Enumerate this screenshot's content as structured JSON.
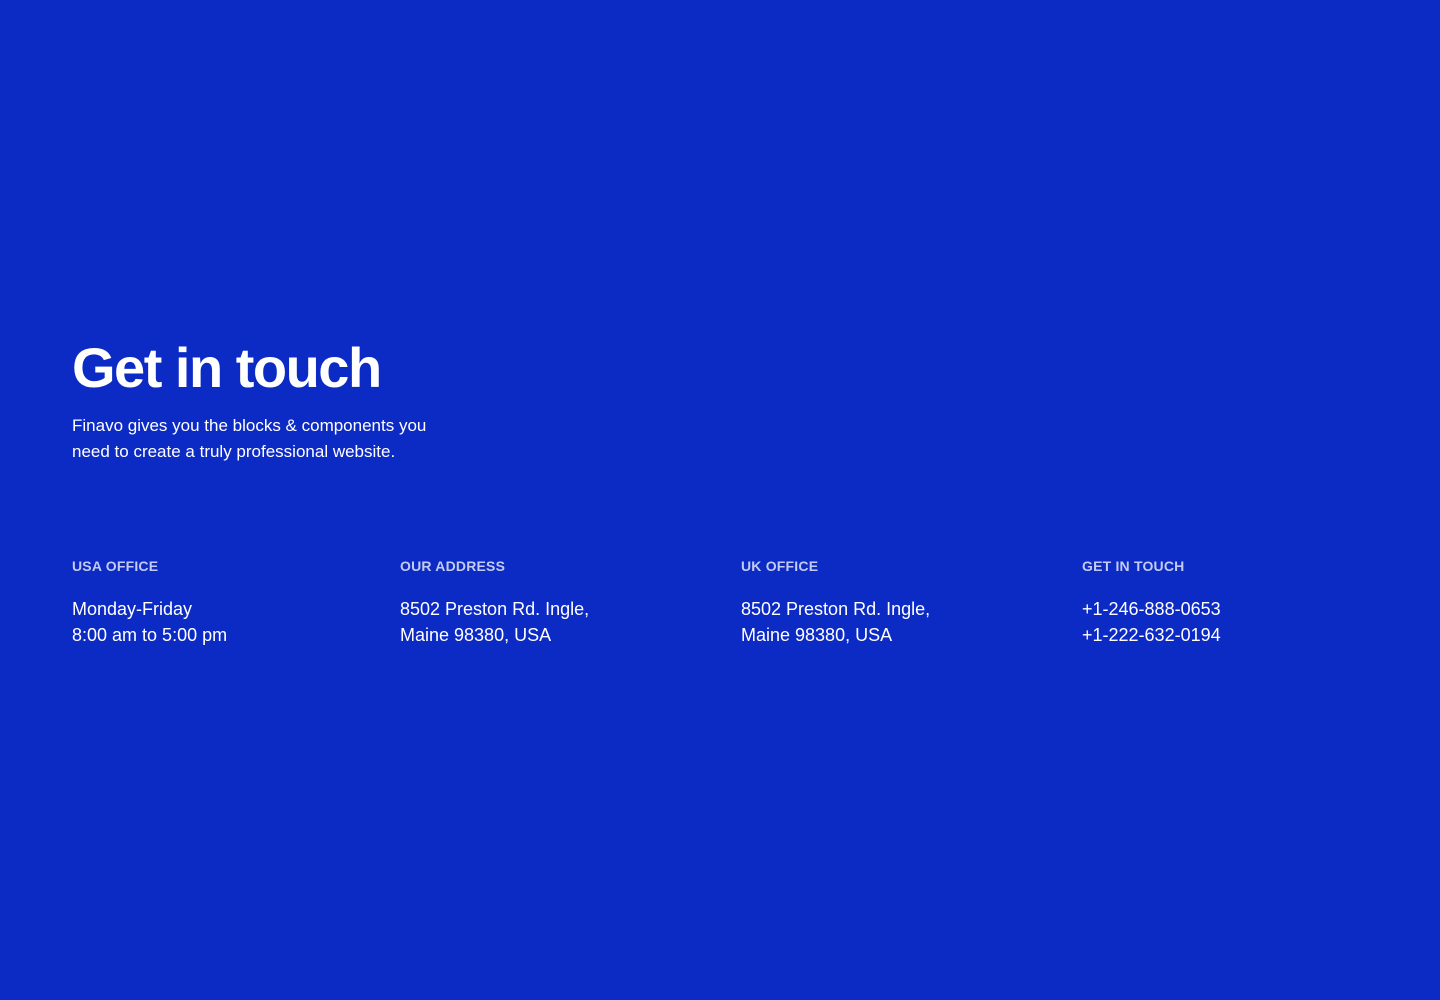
{
  "colors": {
    "background": "#0c2ac4",
    "text": "#ffffff",
    "label": "#c3cbf2"
  },
  "header": {
    "title": "Get in touch",
    "description_line1": "Finavo gives you the blocks & components you",
    "description_line2": "need to create a truly professional website."
  },
  "columns": [
    {
      "label": "USA OFFICE",
      "lines": [
        "Monday-Friday",
        "8:00 am to 5:00 pm"
      ]
    },
    {
      "label": "OUR ADDRESS",
      "lines": [
        "8502 Preston Rd. Ingle,",
        "Maine 98380, USA"
      ]
    },
    {
      "label": "UK OFFICE",
      "lines": [
        "8502 Preston Rd. Ingle,",
        "Maine 98380, USA"
      ]
    },
    {
      "label": "GET IN TOUCH",
      "lines": [
        "+1-246-888-0653",
        "+1-222-632-0194"
      ]
    }
  ]
}
